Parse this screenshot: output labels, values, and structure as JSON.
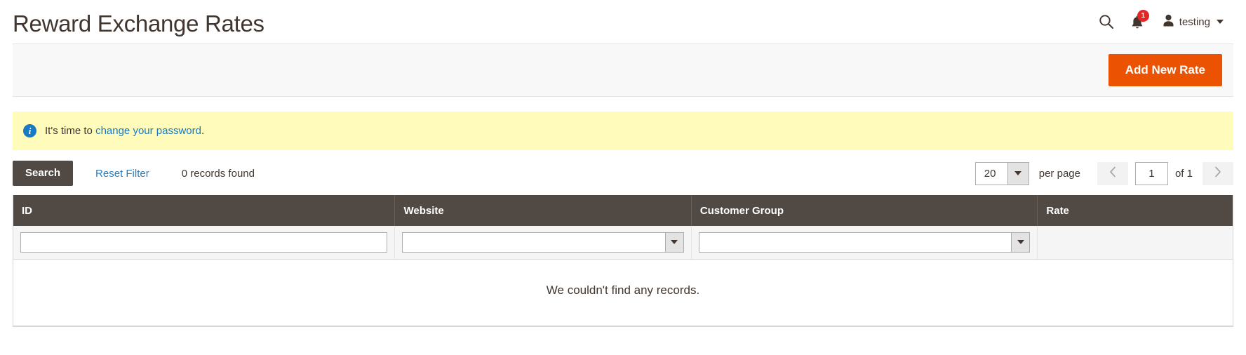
{
  "header": {
    "title": "Reward Exchange Rates",
    "search_icon": "search-icon",
    "notifications_icon": "bell-icon",
    "notifications_count": "1",
    "avatar_icon": "user-avatar-icon",
    "user_name": "testing"
  },
  "actions": {
    "add_new_rate_label": "Add New Rate",
    "accent_color": "#eb5202"
  },
  "message": {
    "icon": "info-icon",
    "text_before": "It's time to",
    "link_text": "change your password",
    "text_after": ".",
    "background_color": "#fffbbb",
    "link_color": "#1979c3"
  },
  "toolbar": {
    "search_label": "Search",
    "reset_filter_label": "Reset Filter",
    "records_found": "0 records found",
    "per_page_value": "20",
    "per_page_label": "per page",
    "prev_icon": "chevron-left-icon",
    "next_icon": "chevron-right-icon",
    "page_value": "1",
    "of_label": "of 1"
  },
  "grid": {
    "columns": [
      {
        "label": "ID",
        "filter": "text",
        "value": ""
      },
      {
        "label": "Website",
        "filter": "select",
        "value": ""
      },
      {
        "label": "Customer Group",
        "filter": "select",
        "value": ""
      },
      {
        "label": "Rate",
        "filter": "none",
        "value": ""
      }
    ],
    "empty_message": "We couldn't find any records.",
    "header_background": "#514943",
    "rows": []
  }
}
